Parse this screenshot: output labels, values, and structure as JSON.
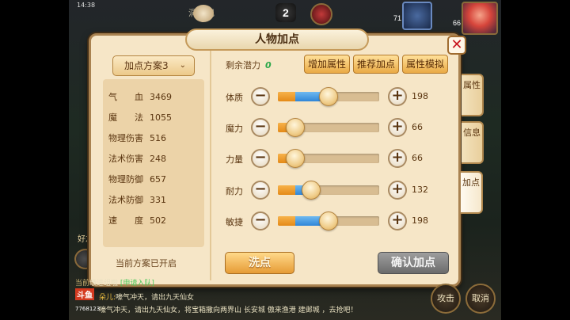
{
  "hud": {
    "time": "14:38",
    "bg_title": "洞賓记",
    "level_badge": "2",
    "avatar_level": "71",
    "avatar_number": "66"
  },
  "panel": {
    "title": "人物加点",
    "close_icon": "close-icon",
    "plan_selector": {
      "label": "加点方案3",
      "chevron": "⌄"
    },
    "stats": [
      {
        "label": "气　　血",
        "value": "3469"
      },
      {
        "label": "魔　　法",
        "value": "1055"
      },
      {
        "label": "物理伤害",
        "value": "516"
      },
      {
        "label": "法术伤害",
        "value": "248"
      },
      {
        "label": "物理防御",
        "value": "657"
      },
      {
        "label": "法术防御",
        "value": "331"
      },
      {
        "label": "速　　度",
        "value": "502"
      }
    ],
    "plan_status": "当前方案已开启",
    "remaining_label": "剩余潜力",
    "remaining_value": "0",
    "top_buttons": [
      "增加属性",
      "推荐加点",
      "属性模拟"
    ],
    "attributes": [
      {
        "label": "体质",
        "value": "198",
        "base_fraction": 0.17,
        "fill_fraction": 0.5
      },
      {
        "label": "魔力",
        "value": "66",
        "base_fraction": 0.17,
        "fill_fraction": 0.17
      },
      {
        "label": "力量",
        "value": "66",
        "base_fraction": 0.17,
        "fill_fraction": 0.17
      },
      {
        "label": "耐力",
        "value": "132",
        "base_fraction": 0.17,
        "fill_fraction": 0.33
      },
      {
        "label": "敏捷",
        "value": "198",
        "base_fraction": 0.17,
        "fill_fraction": 0.5
      }
    ],
    "wash_button": "洗点",
    "confirm_button": "确认加点",
    "side_tabs": [
      "属性",
      "信息",
      "加点"
    ]
  },
  "chat": {
    "line1_prefix": "当前",
    "line1": "级进组啦",
    "line1_link": "[申请入队]",
    "line2_name": "朵儿:",
    "line2": "嚎气冲天，请出九天仙女",
    "line3": "嚎气冲天，请出九天仙女，将宝箱撒向两界山 长安城 傲来渔港 建邺城 ，去抢吧！",
    "douyu_label": "斗鱼",
    "douyu_id": "7768123"
  },
  "bottom_buttons": [
    "攻击",
    "取消"
  ],
  "side_hud": {
    "friend_label": "好友"
  },
  "colors": {
    "panel_bg": "#f6e6c7",
    "accent_orange": "#e69b35",
    "fill_blue": "#2f86d8",
    "remaining_green": "#2da84a",
    "close_red": "#c8141e"
  }
}
